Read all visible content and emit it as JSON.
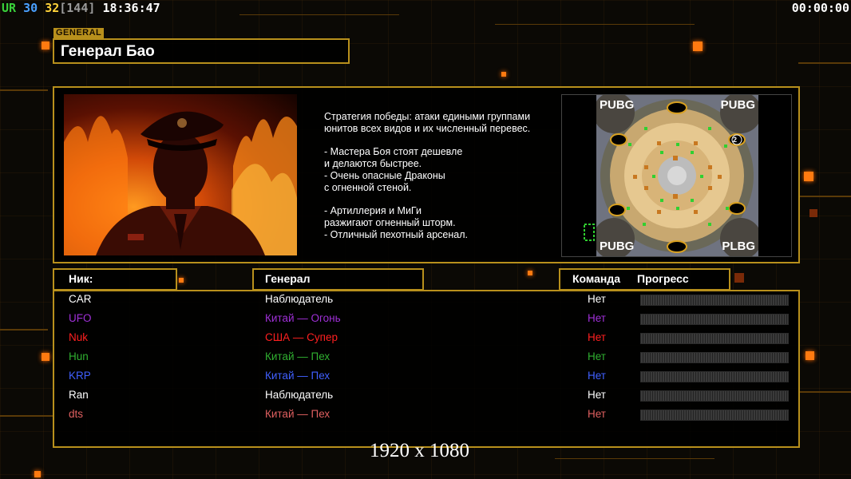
{
  "overlay": {
    "fps_a": "UR",
    "fps_b": "30",
    "fps_c": "32",
    "fps_d": "[144]",
    "clock": "18:36:47",
    "timer": "00:00:00"
  },
  "general": {
    "tag": "GENERAL",
    "name": "Генерал Бао",
    "description": "Стратегия победы: атаки едиными группами\nюнитов всех видов и их численный перевес.\n\n- Мастера Боя стоят дешевле\nи делаются быстрее.\n- Очень опасные Драконы\nс огненной стеной.\n\n- Артиллерия и МиГи\nразжигают огненный шторм.\n- Отличный пехотный арсенал."
  },
  "map": {
    "corner_labels": [
      "PUBG",
      "PUBG",
      "PUBG",
      "PLBG"
    ],
    "marker": "2"
  },
  "columns": {
    "nick": "Ник:",
    "general": "Генерал",
    "team": "Команда",
    "progress": "Прогресс"
  },
  "players": [
    {
      "nick": "CAR",
      "general": "Наблюдатель",
      "team": "Нет",
      "color": "#ffffff",
      "progress": 0
    },
    {
      "nick": "UFO",
      "general": "Китай — Огонь",
      "team": "Нет",
      "color": "#a030d8",
      "progress": 0
    },
    {
      "nick": "Nuk",
      "general": "США — Супер",
      "team": "Нет",
      "color": "#ff2020",
      "progress": 0
    },
    {
      "nick": "Hun",
      "general": "Китай — Пех",
      "team": "Нет",
      "color": "#30b030",
      "progress": 0
    },
    {
      "nick": "KRP",
      "general": "Китай — Пех",
      "team": "Нет",
      "color": "#4060ff",
      "progress": 0
    },
    {
      "nick": "Ran",
      "general": "Наблюдатель",
      "team": "Нет",
      "color": "#ffffff",
      "progress": 0
    },
    {
      "nick": "dts",
      "general": "Китай — Пех",
      "team": "Нет",
      "color": "#e06060",
      "progress": 0
    }
  ],
  "footer": {
    "resolution": "1920 x 1080"
  },
  "colors": {
    "accent": "#b8901c",
    "background": "#0b0905"
  }
}
